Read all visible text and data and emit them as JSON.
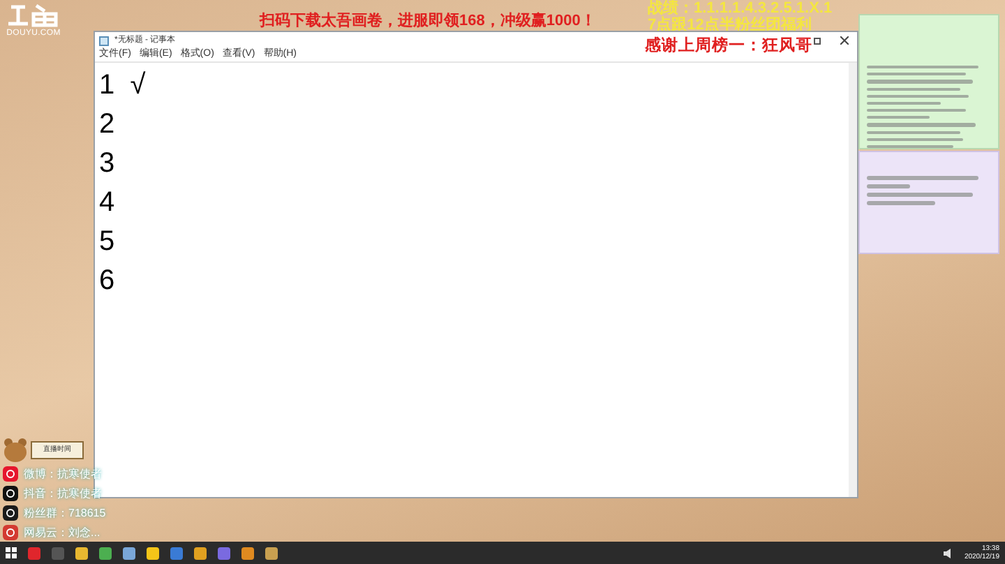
{
  "stream_logo": {
    "site": "DOUYU.COM"
  },
  "overlay": {
    "promo": "扫码下载太吾画卷，进服即领168，冲级赢1000！",
    "record": "战绩：1.1.1.1.4.3.2.5.1.X.1",
    "fan_benefit": "7点跟12点半粉丝团福利",
    "thanks": "感谢上周榜一：狂风哥"
  },
  "notepad": {
    "title": "*无标题 - 记事本",
    "menu": [
      "文件(F)",
      "编辑(E)",
      "格式(O)",
      "查看(V)",
      "帮助(H)"
    ],
    "lines": [
      "1  √",
      "2",
      "3",
      "4",
      "5",
      "6"
    ]
  },
  "streamer_badge": {
    "label": "直播时间"
  },
  "socials": [
    {
      "kind": "weibo",
      "text": "微博：抗寒使者"
    },
    {
      "kind": "douyin",
      "text": "抖音：抗寒使者"
    },
    {
      "kind": "qq",
      "text": "粉丝群：718615"
    },
    {
      "kind": "netease",
      "text": "网易云：刘念..."
    }
  ],
  "taskbar": {
    "time": "13:38",
    "date": "2020/12/19"
  }
}
